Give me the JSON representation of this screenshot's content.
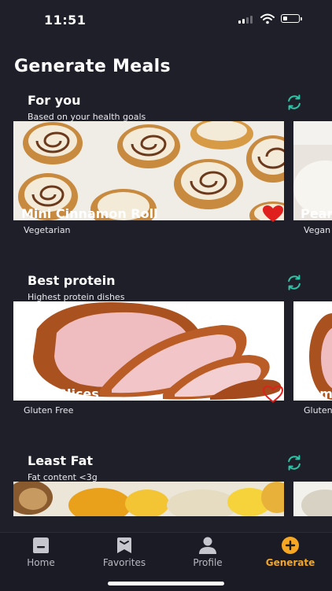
{
  "status_bar": {
    "time": "11:51"
  },
  "page": {
    "title": "Generate Meals"
  },
  "sections": [
    {
      "title": "For you",
      "subtitle": "Based on your health goals",
      "meal": {
        "name": "Mini Cinnamon Roll",
        "tag": "Vegetarian",
        "favorited": true
      },
      "peek": {
        "name": "Pear",
        "tag": "Vegan"
      }
    },
    {
      "title": "Best protein",
      "subtitle": "Highest protein dishes",
      "meal": {
        "name": "Ham Slices",
        "tag": "Gluten Free",
        "favorited": false
      },
      "peek": {
        "name": "Ham",
        "tag": "Gluten"
      }
    },
    {
      "title": "Least Fat",
      "subtitle": "Fat content <3g"
    }
  ],
  "nav": {
    "items": [
      {
        "label": "Home",
        "icon": "home-icon"
      },
      {
        "label": "Favorites",
        "icon": "bookmark-icon"
      },
      {
        "label": "Profile",
        "icon": "person-icon"
      },
      {
        "label": "Generate",
        "icon": "plus-circle-icon",
        "active": true
      }
    ]
  },
  "colors": {
    "background": "#1f1f2a",
    "accent": "#f5a623",
    "refresh": "#2ec4a6",
    "heart": "#e0201c"
  }
}
